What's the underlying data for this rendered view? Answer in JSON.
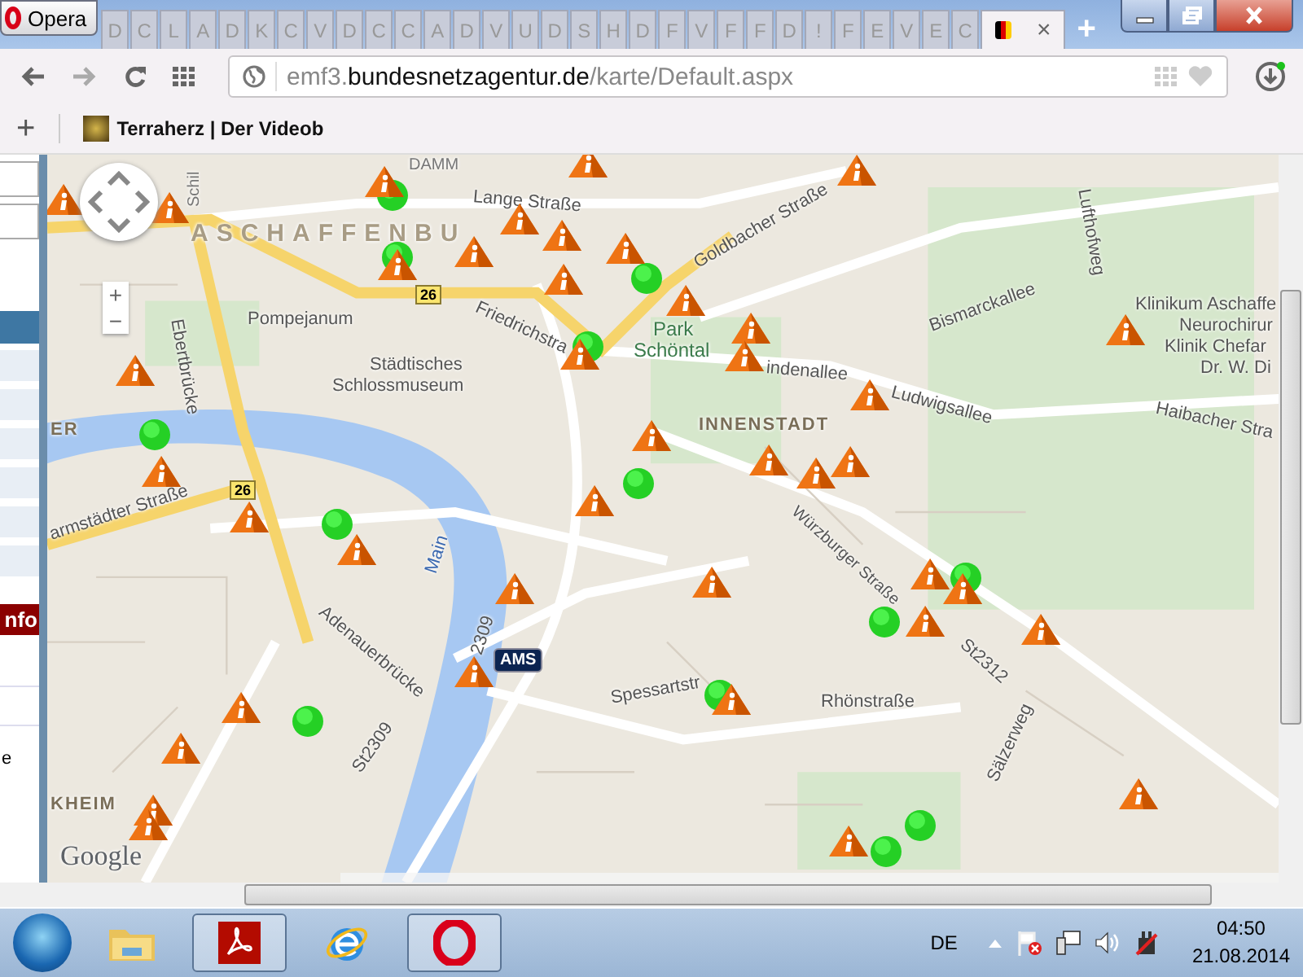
{
  "browser": {
    "app_button": "Opera",
    "tabs": [
      {
        "label": "D",
        "selected": false
      },
      {
        "label": "C",
        "selected": false
      },
      {
        "label": "L",
        "selected": false
      },
      {
        "label": "A",
        "selected": false
      },
      {
        "label": "D",
        "selected": false
      },
      {
        "label": "K",
        "selected": false
      },
      {
        "label": "C",
        "selected": false
      },
      {
        "label": "V",
        "selected": false
      },
      {
        "label": "D",
        "selected": false
      },
      {
        "label": "C",
        "selected": false
      },
      {
        "label": "C",
        "selected": false
      },
      {
        "label": "A",
        "selected": false
      },
      {
        "label": "D",
        "selected": false
      },
      {
        "label": "V",
        "selected": false
      },
      {
        "label": "U",
        "selected": false
      },
      {
        "label": "D",
        "selected": false
      },
      {
        "label": "S",
        "selected": false
      },
      {
        "label": "H",
        "selected": false
      },
      {
        "label": "D",
        "selected": false
      },
      {
        "label": "F",
        "selected": false
      },
      {
        "label": "V",
        "selected": false
      },
      {
        "label": "F",
        "selected": false
      },
      {
        "label": "F",
        "selected": false
      },
      {
        "label": "D",
        "selected": false
      },
      {
        "label": "!",
        "selected": false
      },
      {
        "label": "F",
        "selected": false
      },
      {
        "label": "E",
        "selected": false
      },
      {
        "label": "V",
        "selected": false
      },
      {
        "label": "E",
        "selected": false
      },
      {
        "label": "C",
        "selected": false
      },
      {
        "close": "×",
        "selected": true
      }
    ],
    "new_tab": "+"
  },
  "address_bar": {
    "url_prefix": "emf3.",
    "url_domain": "bundesnetzagentur.de",
    "url_path": "/karte/Default.aspx"
  },
  "bookmarks": {
    "add": "+",
    "items": [
      "Terraherz | Der Videob"
    ]
  },
  "sidebar": {
    "button": "nfo",
    "text": "e"
  },
  "map": {
    "labels": [
      "DAMM",
      "Lange Straße",
      "ASCHAFFENBU",
      "Schil",
      "Ebertbrücke",
      "Pompejanum",
      "Städtisches",
      "Schlossmuseum",
      "Friedrichstra",
      "Goldbacher Straße",
      "Park",
      "Schöntal",
      "indenallee",
      "INNENSTADT",
      "Ludwigsallee",
      "Bismarckallee",
      "Lufthofweg",
      "Klinikum Aschaffe",
      "Neurochirur",
      "Klinik Chefar",
      "Dr. W. Di",
      "Haibacher Stra",
      "Würzburger Straße",
      "St2312",
      "Rhönstraße",
      "Sälzerweg",
      "Spessartstr",
      "Adenauerbrücke",
      "St2309",
      "2309",
      "Main",
      "armstädter Straße",
      "ER",
      "KHEIM"
    ],
    "route_badges": [
      "26",
      "26"
    ],
    "station_badge": "AMS",
    "zoom_in": "+",
    "zoom_out": "−",
    "logo": "Google"
  },
  "taskbar": {
    "apps": [
      {
        "kind": "folder",
        "open": false
      },
      {
        "kind": "pdf",
        "open": true
      },
      {
        "kind": "ie",
        "open": false
      },
      {
        "kind": "opera",
        "open": true
      }
    ],
    "language": "DE",
    "time": "04:50",
    "date": "21.08.2014"
  }
}
